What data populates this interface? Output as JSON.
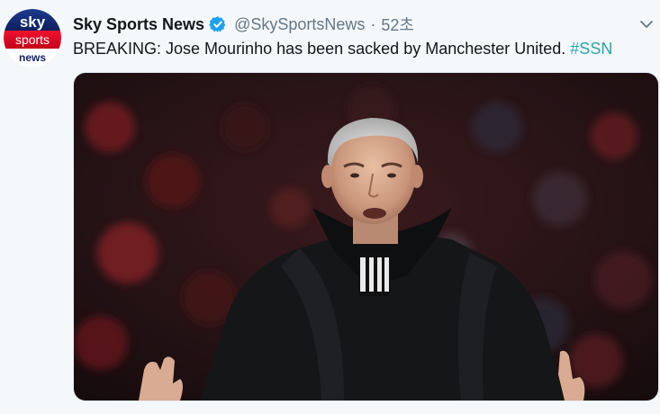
{
  "tweet": {
    "display_name": "Sky Sports News",
    "handle": "@SkySportsNews",
    "separator": "·",
    "time": "52초",
    "text": "BREAKING: Jose Mourinho has been sacked by Manchester United.",
    "hashtag": "#SSN"
  },
  "avatar": {
    "logo_top": "sky",
    "logo_middle": "sports",
    "logo_bottom": "news"
  },
  "icons": {
    "verified": "verified-badge-icon",
    "caret": "chevron-down-icon"
  },
  "colors": {
    "verified_blue": "#1da1f2",
    "hashtag": "#2aa4a9",
    "sky_red": "#e2001a",
    "sky_navy": "#12246b",
    "text": "#14171a",
    "muted": "#657786"
  }
}
